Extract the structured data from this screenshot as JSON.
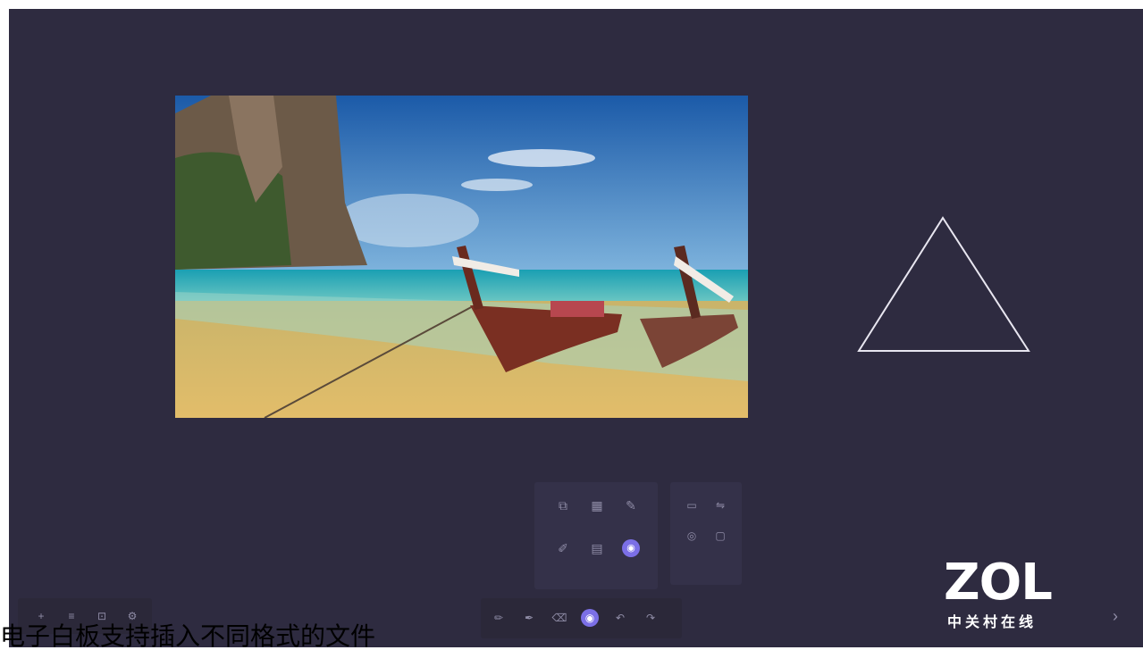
{
  "canvas": {
    "background": "#2e2b40"
  },
  "photo": {
    "description_icon": "beach-longtail-boats-image"
  },
  "shape": {
    "type": "triangle",
    "stroke": "#e8e6f0"
  },
  "toolbox": {
    "tools": [
      {
        "icon": "screenshot-icon",
        "glyph": "⧉",
        "label": ""
      },
      {
        "icon": "grid-icon",
        "glyph": "▦",
        "label": ""
      },
      {
        "icon": "pen-tool-icon",
        "glyph": "✎",
        "label": ""
      },
      {
        "icon": "brush-icon",
        "glyph": "✐",
        "label": ""
      },
      {
        "icon": "document-icon",
        "glyph": "▤",
        "label": ""
      },
      {
        "icon": "insert-icon",
        "glyph": "◉",
        "label": ""
      }
    ],
    "side_tools": [
      {
        "icon": "rectangle-icon",
        "glyph": "▭"
      },
      {
        "icon": "split-icon",
        "glyph": "⇋"
      },
      {
        "icon": "eye-icon",
        "glyph": "◎"
      },
      {
        "icon": "frame-icon",
        "glyph": "▢"
      }
    ]
  },
  "bottom_left": [
    {
      "icon": "add-icon",
      "glyph": "+"
    },
    {
      "icon": "list-icon",
      "glyph": "≡"
    },
    {
      "icon": "display-icon",
      "glyph": "⊡"
    },
    {
      "icon": "settings-icon",
      "glyph": "⚙"
    }
  ],
  "bottom_center": [
    {
      "icon": "pencil-icon",
      "glyph": "✏"
    },
    {
      "icon": "marker-icon",
      "glyph": "✒"
    },
    {
      "icon": "eraser-icon",
      "glyph": "⌫"
    },
    {
      "icon": "tools-icon",
      "glyph": "◉",
      "active": true
    },
    {
      "icon": "undo-icon",
      "glyph": "↶"
    },
    {
      "icon": "redo-icon",
      "glyph": "↷"
    }
  ],
  "bottom_right": [
    {
      "icon": "next-page-icon",
      "glyph": "›"
    }
  ],
  "watermark": {
    "brand": "ZOL",
    "subtitle": "中关村在线"
  },
  "caption": "电子白板支持插入不同格式的文件"
}
